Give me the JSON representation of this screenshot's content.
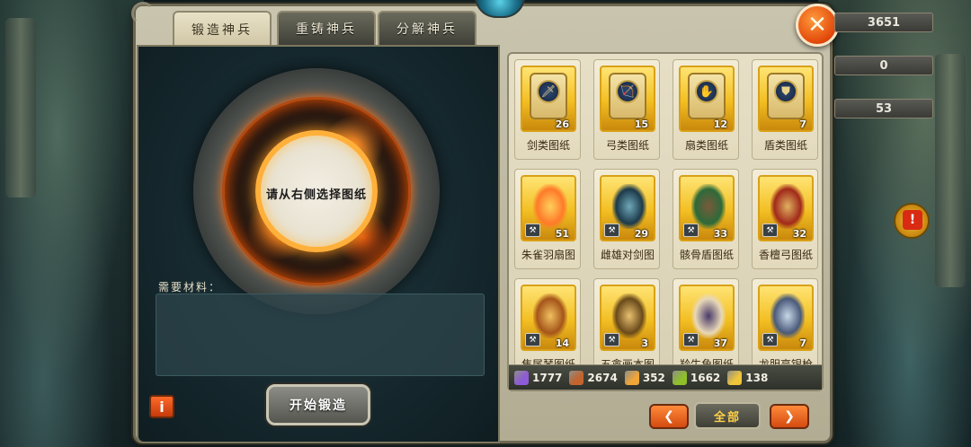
{
  "tabs": [
    {
      "label": "锻造神兵",
      "active": true
    },
    {
      "label": "重铸神兵",
      "active": false
    },
    {
      "label": "分解神兵",
      "active": false
    }
  ],
  "forge": {
    "prompt": "请从右侧选择图纸",
    "materials_label": "需要材料：",
    "start_button": "开始锻造",
    "info_glyph": "i"
  },
  "stats": [
    "3651",
    "0",
    "53"
  ],
  "close_glyph": "✕",
  "alert_glyph": "!",
  "blueprints": [
    {
      "name": "剑类图纸",
      "count": "26",
      "icon": "sword-scroll-icon",
      "glyph": "🗡"
    },
    {
      "name": "弓类图纸",
      "count": "15",
      "icon": "bow-scroll-icon",
      "glyph": "🏹"
    },
    {
      "name": "扇类图纸",
      "count": "12",
      "icon": "fan-scroll-icon",
      "glyph": "✋"
    },
    {
      "name": "盾类图纸",
      "count": "7",
      "icon": "shield-scroll-icon",
      "glyph": "⛊"
    },
    {
      "name": "朱雀羽扇图",
      "count": "51",
      "icon": "phoenix-fan-icon",
      "glyph": ""
    },
    {
      "name": "雌雄对剑图",
      "count": "29",
      "icon": "twin-swords-icon",
      "glyph": ""
    },
    {
      "name": "骸骨盾图纸",
      "count": "33",
      "icon": "skull-shield-icon",
      "glyph": ""
    },
    {
      "name": "香檀弓图纸",
      "count": "32",
      "icon": "sandalwood-bow-icon",
      "glyph": ""
    },
    {
      "name": "焦尾琴图纸",
      "count": "14",
      "icon": "zither-icon",
      "glyph": ""
    },
    {
      "name": "五禽画本图",
      "count": "3",
      "icon": "painting-scroll-icon",
      "glyph": ""
    },
    {
      "name": "羚牛角图纸",
      "count": "37",
      "icon": "horn-icon",
      "glyph": ""
    },
    {
      "name": "龙胆亮银枪",
      "count": "7",
      "icon": "silver-spear-icon",
      "glyph": ""
    }
  ],
  "resources": [
    {
      "value": "1777",
      "icon": "purple-crystal-icon",
      "color": "#8e5bd6"
    },
    {
      "value": "2674",
      "icon": "copper-ingot-icon",
      "color": "#c3642e"
    },
    {
      "value": "352",
      "icon": "feather-icon",
      "color": "#f0a53a"
    },
    {
      "value": "1662",
      "icon": "green-leaf-icon",
      "color": "#8fbf2a"
    },
    {
      "value": "138",
      "icon": "gold-feather-icon",
      "color": "#f0c53a"
    }
  ],
  "pagination": {
    "prev": "❮",
    "all": "全部",
    "next": "❯"
  }
}
